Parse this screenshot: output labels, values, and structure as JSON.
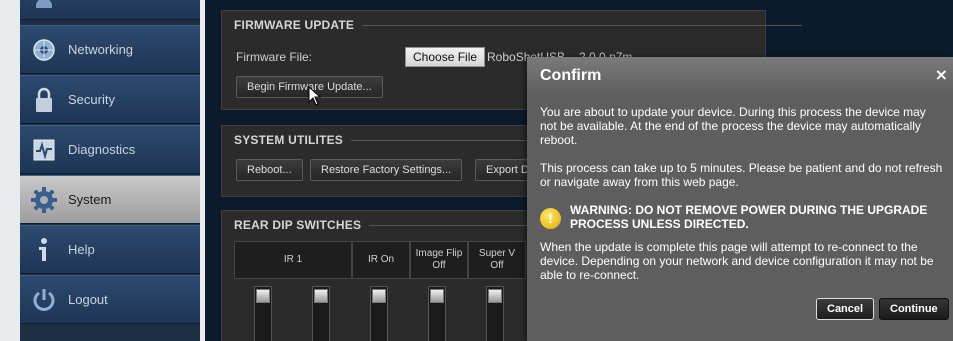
{
  "sidebar": {
    "items": [
      {
        "label": "",
        "icon": "partial-icon"
      },
      {
        "label": "Networking",
        "icon": "networking-icon"
      },
      {
        "label": "Security",
        "icon": "lock-icon"
      },
      {
        "label": "Diagnostics",
        "icon": "diagnostics-icon"
      },
      {
        "label": "System",
        "icon": "gear-icon"
      },
      {
        "label": "Help",
        "icon": "help-icon"
      },
      {
        "label": "Logout",
        "icon": "power-icon"
      }
    ],
    "active": "System"
  },
  "firmware": {
    "title": "FIRMWARE UPDATE",
    "file_label": "Firmware File:",
    "choose_file": "Choose File",
    "file_name": "RoboShotUSB...-2.0.0.p7m",
    "begin_update": "Begin Firmware Update..."
  },
  "utilities": {
    "title": "SYSTEM UTILITES",
    "reboot": "Reboot...",
    "restore": "Restore Factory Settings...",
    "export": "Export D"
  },
  "dip": {
    "title": "REAR DIP SWITCHES",
    "headers": [
      {
        "line1": "IR 1",
        "line2": ""
      },
      {
        "line1": "IR On",
        "line2": ""
      },
      {
        "line1": "Image Flip",
        "line2": "Off"
      },
      {
        "line1": "Super V",
        "line2": "Off"
      }
    ]
  },
  "modal": {
    "title": "Confirm",
    "close_symbol": "×",
    "p1": "You are about to update your device. During this process the device may not be available. At the end of the process the device may automatically reboot.",
    "p2": "This process can take up to 5 minutes. Please be patient and do not refresh or navigate away from this web page.",
    "warning_symbol": "!",
    "warning": "WARNING: DO NOT REMOVE POWER DURING THE UPGRADE PROCESS UNLESS DIRECTED.",
    "p3": "When the update is complete this page will attempt to re-connect to the device. Depending on your network and device configuration it may not be able to re-connect.",
    "cancel": "Cancel",
    "continue": "Continue"
  },
  "colors": {
    "sidebar_bg": "#1e3655",
    "content_bg": "#0c1b2b",
    "panel_bg": "#2b2b2b",
    "modal_bg": "#5e5e5e",
    "warning_icon": "#f2c200"
  }
}
